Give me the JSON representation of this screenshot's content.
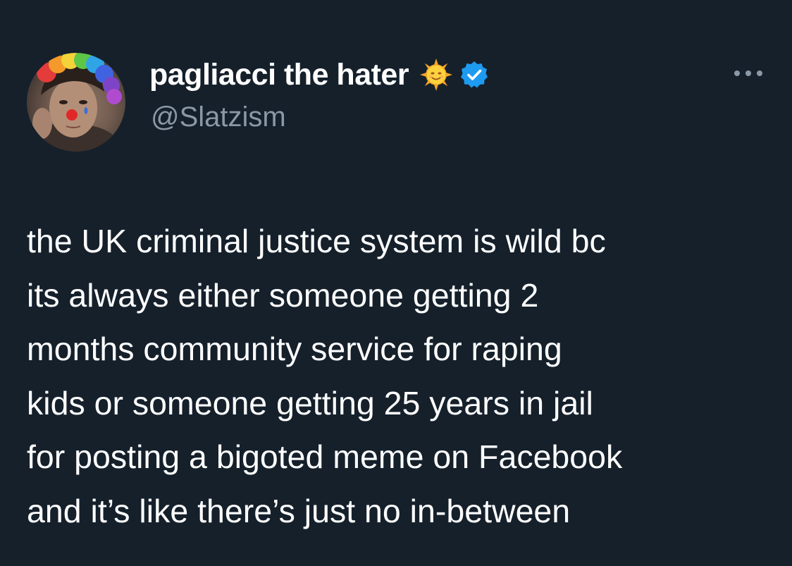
{
  "author": {
    "display_name": "pagliacci the hater",
    "handle": "@Slatzism",
    "emoji": "🌞",
    "verified": true
  },
  "icons": {
    "avatar": "avatar",
    "sun": "sun-with-face-icon",
    "verified": "verified-badge-icon",
    "more": "more-options-icon"
  },
  "colors": {
    "background": "#15202b",
    "text": "#ffffff",
    "secondary_text": "#8b98a5",
    "verified_blue": "#1d9bf0"
  },
  "tweet": {
    "lines": [
      "the UK criminal justice system is wild bc",
      "its always either someone getting 2",
      "months community service for raping",
      "kids or someone getting 25 years in jail",
      "for posting a bigoted meme on Facebook",
      "and it’s like there’s just no in-between"
    ]
  }
}
